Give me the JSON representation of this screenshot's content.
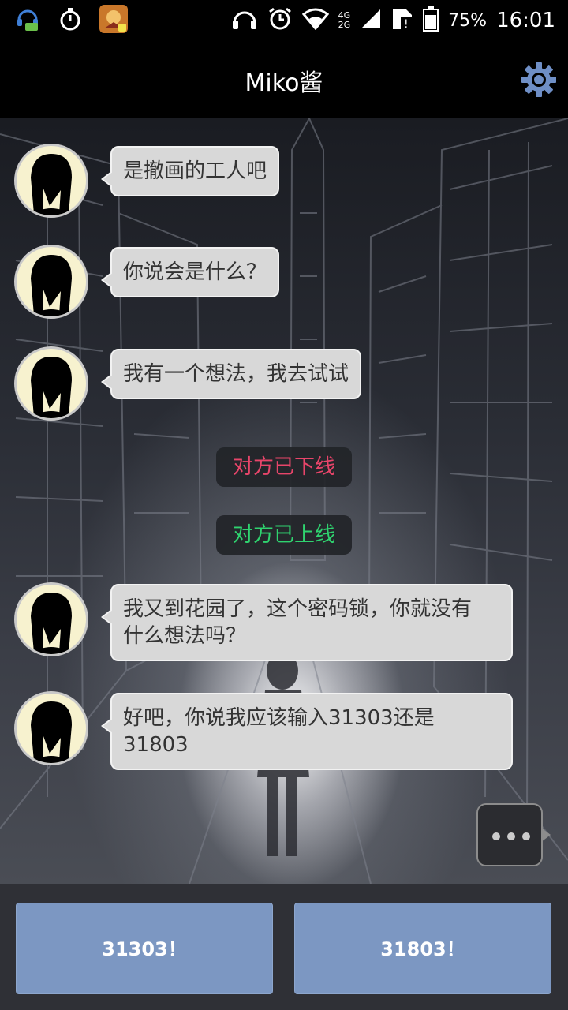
{
  "status_bar": {
    "signal_labels": [
      "4G",
      "2G"
    ],
    "battery": "75%",
    "time": "16:01"
  },
  "app_bar": {
    "title": "Miko酱",
    "settings_icon": "gear-icon"
  },
  "messages": [
    {
      "type": "incoming",
      "text": "是撤画的工人吧"
    },
    {
      "type": "incoming",
      "text": "你说会是什么？"
    },
    {
      "type": "incoming",
      "text": "我有一个想法，我去试试"
    },
    {
      "type": "system",
      "text": "对方已下线",
      "color": "#e8456a"
    },
    {
      "type": "system",
      "text": "对方已上线",
      "color": "#2fd36f"
    },
    {
      "type": "incoming",
      "line1": "我又到花园了，这个密码锁，你就没有",
      "line2": "什么想法吗？"
    },
    {
      "type": "incoming",
      "line1": "好吧，你说我应该输入31303还是",
      "line2": "31803"
    }
  ],
  "more_button_icon": "ellipsis-icon",
  "choices": [
    {
      "label": "31303！"
    },
    {
      "label": "31803！"
    }
  ],
  "colors": {
    "choice_button": "#7c97c2",
    "bubble": "#d8d8d8",
    "accent_gear": "#6f8fc6"
  }
}
